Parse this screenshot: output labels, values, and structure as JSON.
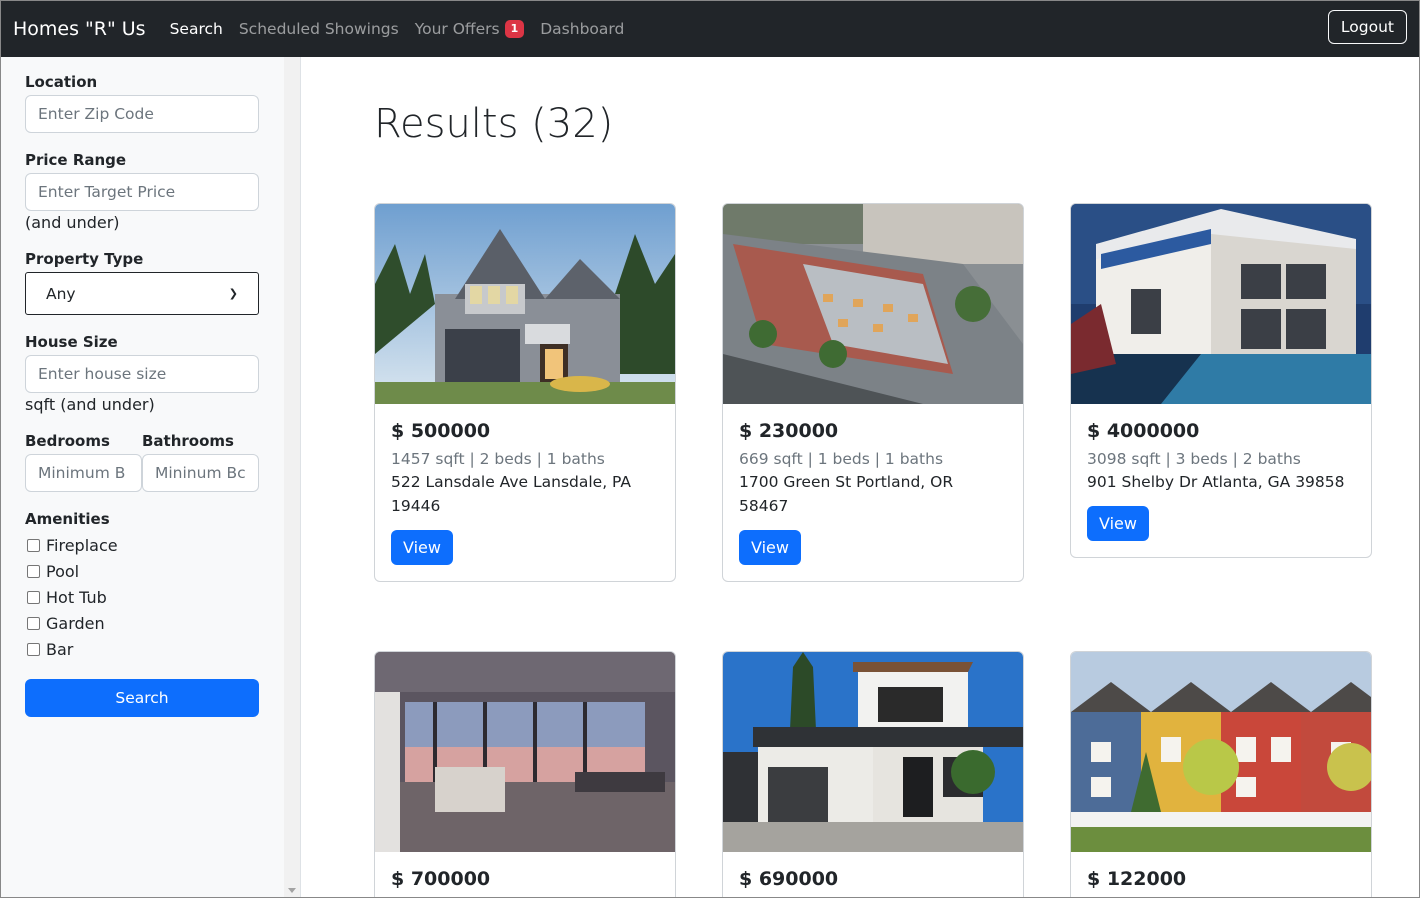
{
  "navbar": {
    "brand": "Homes \"R\" Us",
    "links": [
      {
        "label": "Search",
        "active": true
      },
      {
        "label": "Scheduled Showings",
        "active": false
      },
      {
        "label": "Your Offers",
        "active": false,
        "badge": "1"
      },
      {
        "label": "Dashboard",
        "active": false
      }
    ],
    "logout_label": "Logout"
  },
  "sidebar": {
    "location_label": "Location",
    "location_placeholder": "Enter Zip Code",
    "price_label": "Price Range",
    "price_placeholder": "Enter Target Price",
    "price_helper": "(and under)",
    "property_type_label": "Property Type",
    "property_type_value": "Any",
    "house_size_label": "House Size",
    "house_size_placeholder": "Enter house size",
    "house_size_helper": "sqft (and under)",
    "bedrooms_label": "Bedrooms",
    "bedrooms_placeholder": "Minimum B",
    "bathrooms_label": "Bathrooms",
    "bathrooms_placeholder": "Mininum Bc",
    "amenities_label": "Amenities",
    "amenities": [
      "Fireplace",
      "Pool",
      "Hot Tub",
      "Garden",
      "Bar"
    ],
    "search_label": "Search"
  },
  "results": {
    "title": "Results (32)",
    "view_label": "View",
    "cards": [
      {
        "price": "$ 500000",
        "meta": "1457 sqft | 2 beds | 1 baths",
        "address": "522 Lansdale Ave Lansdale, PA 19446",
        "image": "suburban-house"
      },
      {
        "price": "$ 230000",
        "meta": "669 sqft | 1 beds | 1 baths",
        "address": "1700 Green St Portland, OR 58467",
        "image": "townhouses-aerial"
      },
      {
        "price": "$ 4000000",
        "meta": "3098 sqft | 3 beds | 2 baths",
        "address": "901 Shelby Dr Atlanta, GA 39858",
        "image": "modern-villa-pool"
      },
      {
        "price": "$ 700000",
        "meta": "",
        "address": "",
        "image": "apartment-interior"
      },
      {
        "price": "$ 690000",
        "meta": "",
        "address": "",
        "image": "modern-house"
      },
      {
        "price": "$ 122000",
        "meta": "",
        "address": "",
        "image": "colorful-rowhouses"
      }
    ]
  }
}
